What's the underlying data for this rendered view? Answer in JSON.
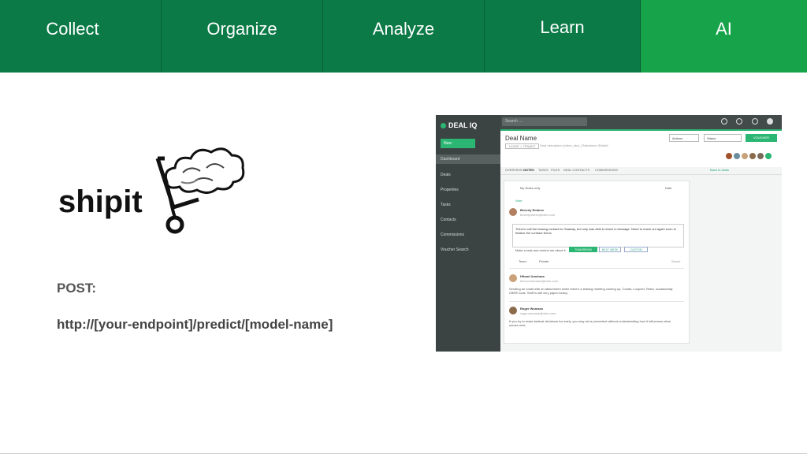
{
  "nav": {
    "tabs": [
      {
        "label": "Collect"
      },
      {
        "label": "Organize"
      },
      {
        "label": "Analyze"
      },
      {
        "label": "Learn"
      },
      {
        "label": "AI"
      }
    ]
  },
  "logo": {
    "text": "shipit"
  },
  "post_label": "POST:",
  "endpoint_url": "http://[your-endpoint]/predict/[model-name]",
  "screenshot": {
    "brand": "DEAL IQ",
    "new_button": "New",
    "sidebar": [
      "Dashboard",
      "Deals",
      "Properties",
      "Tasks",
      "Contacts",
      "Commissions",
      "Voucher Search"
    ],
    "search_placeholder": "Search ...",
    "deal_name": "Deal Name",
    "deal_stage": "LEASE > TENANT",
    "deal_desc": "Deal description (client_abc) | Salesforce ID####",
    "actions_label": "Actions",
    "status_label": "Status",
    "voucher_label": "VOUCHER",
    "subtabs": [
      "OVERVIEW",
      "NOTES",
      "TASKS",
      "FILES",
      "DEAL CONTACTS",
      "COMMISSIONS"
    ],
    "back_link": "Back to deals",
    "my_notes": "My Notes only",
    "date_sort": "Date",
    "add_note": "Note",
    "author1": "Beverly Embrez",
    "author1_email": "beverly.ebrez@cbre.com",
    "note_text": "Tried to call the leasing contact for Saaway, but only was able to leave a message. Need to reach out again soon to finalize the contract terms.",
    "remind": "Make a task and remind me about it",
    "chips": [
      "TOMORROW",
      "NEXT WEEK",
      "CUSTOM"
    ],
    "team": "Team",
    "private": "Private",
    "saved": "Saved",
    "author2": "Hitomi Umehara",
    "author2_email": "hitomi.umehara@cbre.com",
    "note2": "Sending an email with an attachment when there's a leasing meeting coming up. Costar, Loopnet, Reba, occasionally CBRE tools. Stuff is still very paper-heavy.",
    "author3": "Roger Womack",
    "author3_email": "roger.womack@cbre.com",
    "note3": "If you try to make tactical decisions too early, you may set a precedent without understanding how it influences what comes next."
  },
  "colors": {
    "tab_dark": "#0b7a47",
    "tab_active": "#16a34a"
  }
}
